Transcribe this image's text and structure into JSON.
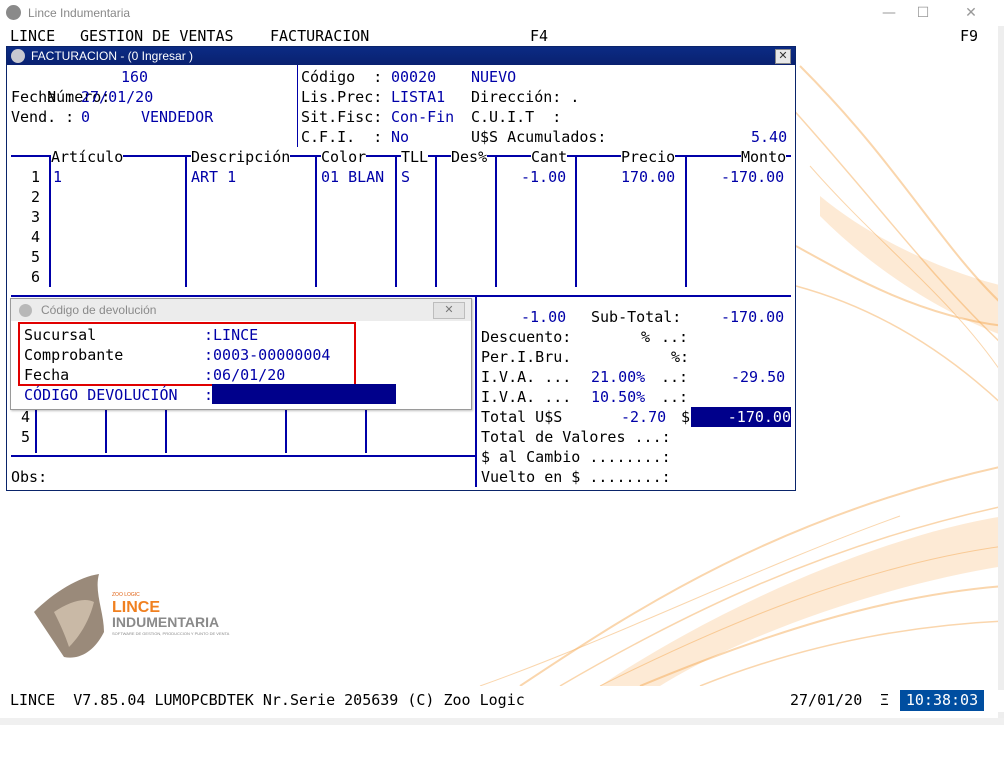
{
  "window": {
    "title": "Lince Indumentaria",
    "minimize": "—",
    "maximize": "☐",
    "close": "✕"
  },
  "menu": {
    "item1": "LINCE",
    "item2": "GESTION DE VENTAS",
    "item3": "FACTURACION",
    "key_left": "F4",
    "key_right": "F9"
  },
  "factura": {
    "title": "FACTURACION - (0 Ingresar )",
    "close": "✕",
    "numero_label": "Número:",
    "numero": "160",
    "fecha_label": "Fecha :",
    "fecha": "27/01/20",
    "vend_label": "Vend. :",
    "vend_code": "0",
    "vend_name": "VENDEDOR",
    "codigo_label": "Código  :",
    "codigo": "00020",
    "estado": "NUEVO",
    "lisprec_label": "Lis.Prec:",
    "lisprec": "LISTA1",
    "direccion_label": "Dirección: .",
    "sitfisc_label": "Sit.Fisc:",
    "sitfisc": "Con-Fin",
    "cuit_label": "C.U.I.T  :",
    "cfi_label": "C.F.I.  :",
    "cfi": "No",
    "acum_label": "U$S Acumulados:",
    "acum": "5.40"
  },
  "grid": {
    "headers": {
      "articulo": "Artículo",
      "descripcion": "Descripción",
      "color": "Color",
      "tll": "TLL",
      "des": "Des%",
      "cant": "Cant",
      "precio": "Precio",
      "monto": "Monto"
    },
    "row_numbers": [
      "1",
      "2",
      "3",
      "4",
      "5",
      "6"
    ],
    "row1": {
      "articulo": "1",
      "descripcion": "ART 1",
      "color": "01 BLAN",
      "tll": "S",
      "cant": "-1.00",
      "precio": "170.00",
      "monto": "-170.00"
    }
  },
  "valores": {
    "row_numbers": [
      "4",
      "5"
    ],
    "obs_label": "Obs:"
  },
  "totales": {
    "cant_total": "-1.00",
    "subtotal_label": "Sub-Total:",
    "subtotal": "-170.00",
    "descuento_label": "Descuento:",
    "descuento_pct": "%",
    "descuento_dots": "..:",
    "perib_label": "Per.I.Bru.",
    "perib_pct": "%:",
    "iva1_label": "I.V.A. ...",
    "iva1_rate": "21.00%",
    "iva1_dots": "..:",
    "iva1_value": "-29.50",
    "iva2_label": "I.V.A. ...",
    "iva2_rate": "10.50%",
    "iva2_dots": "..:",
    "total_label": "Total U$S",
    "total_usd": "-2.70",
    "dollar": "$",
    "total": "-170.00",
    "valores_label": "Total de Valores ...:",
    "cambio_label": "$ al Cambio ........:",
    "vuelto_label": "Vuelto en $ ........:"
  },
  "popup": {
    "title": "Código de devolución",
    "close": "✕",
    "sucursal_label": "Sucursal",
    "sucursal": ":LINCE",
    "comprobante_label": "Comprobante",
    "comprobante": ":0003-00000004",
    "fecha_label": "Fecha",
    "fecha": ":06/01/20",
    "codigo_label": "CÓDIGO DEVOLUCIÓN",
    "codigo_colon": ":",
    "codigo_value": ""
  },
  "logo": {
    "brand_small": "ZOO LOGIC",
    "line1": "LINCE",
    "line2": "INDUMENTARIA",
    "tagline": "SOFTWARE DE GESTION, PRODUCCION Y PUNTO DE VENTA"
  },
  "status": {
    "left": "LINCE  V7.85.04 LUMOPCBDTEK Nr.Serie 205639 (C) Zoo Logic",
    "date": "27/01/20",
    "sep": "Ξ",
    "time": "10:38:03"
  },
  "colors": {
    "accent": "#0000a8",
    "title_bar": "#0a246a",
    "highlight_box": "#e00000",
    "clock_bg": "#004ea0",
    "orange": "#f4a040"
  }
}
